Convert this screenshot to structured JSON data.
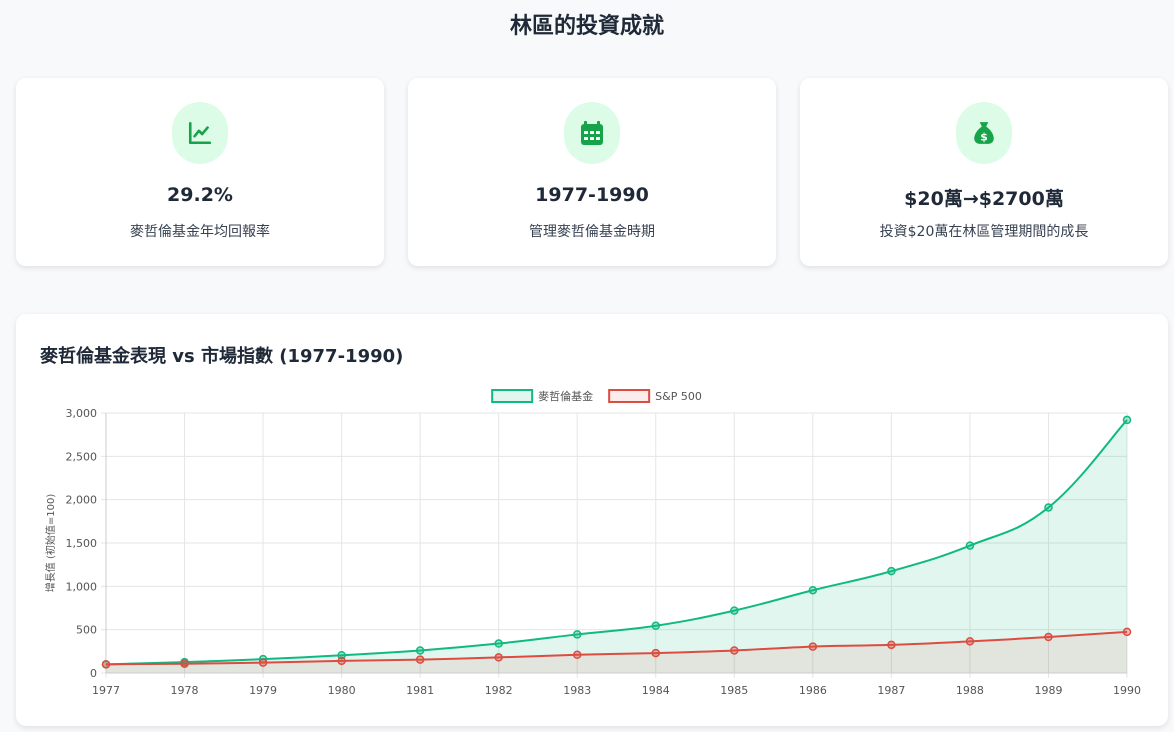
{
  "page": {
    "title": "林區的投資成就"
  },
  "stats": [
    {
      "icon": "chart-line-icon",
      "value": "29.2%",
      "label": "麥哲倫基金年均回報率"
    },
    {
      "icon": "calendar-icon",
      "value": "1977-1990",
      "label": "管理麥哲倫基金時期"
    },
    {
      "icon": "money-bag-icon",
      "value": "$20萬→$2700萬",
      "label": "投資$20萬在林區管理期間的成長"
    }
  ],
  "chart": {
    "title": "麥哲倫基金表現 vs 市場指數 (1977-1990)"
  },
  "colors": {
    "accent": "#16a34a",
    "accent_bg": "#dcfce7",
    "fund_line": "#10b981",
    "fund_fill": "rgba(16,185,129,0.12)",
    "sp_line": "#dc4c41",
    "sp_fill": "rgba(220,76,65,0.10)"
  },
  "chart_data": {
    "type": "line",
    "x": [
      "1977",
      "1978",
      "1979",
      "1980",
      "1981",
      "1982",
      "1983",
      "1984",
      "1985",
      "1986",
      "1987",
      "1988",
      "1989",
      "1990"
    ],
    "series": [
      {
        "name": "麥哲倫基金",
        "values": [
          100,
          125,
          160,
          205,
          260,
          340,
          445,
          545,
          720,
          955,
          1175,
          1470,
          1910,
          2920
        ]
      },
      {
        "name": "S&P 500",
        "values": [
          100,
          107,
          120,
          140,
          155,
          180,
          210,
          230,
          260,
          305,
          325,
          365,
          415,
          475
        ]
      }
    ],
    "title": "",
    "xlabel": "",
    "ylabel": "增長值 (初始值=100)",
    "ylim": [
      0,
      3000
    ],
    "yticks": [
      0,
      500,
      1000,
      1500,
      2000,
      2500,
      3000
    ],
    "ytick_labels": [
      "0",
      "500",
      "1,000",
      "1,500",
      "2,000",
      "2,500",
      "3,000"
    ],
    "grid": true,
    "legend": "top-center",
    "fill": true
  }
}
